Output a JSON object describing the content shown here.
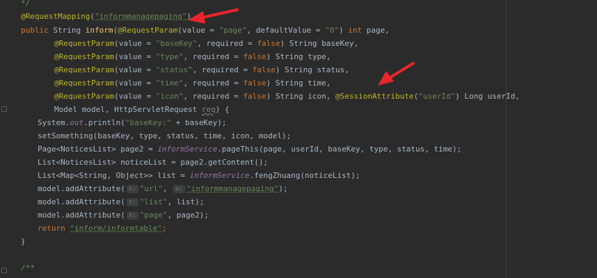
{
  "editor": {
    "tokens": {
      "comment_end": "*/",
      "request_mapping": "@RequestMapping",
      "lparen": "(",
      "rparen": ")",
      "mapping_value": "\"informmanagepaging\"",
      "public": "public",
      "string_type": " String ",
      "method_name": "inform",
      "request_param": "@RequestParam",
      "value_eq": "(value = ",
      "page_str": "\"page\"",
      "default_value": ", defaultValue = ",
      "zero_str": "\"0\"",
      "int_kw": "int",
      "page_param": " page,",
      "basekey_str": "\"baseKey\"",
      "required": ", required = ",
      "false_kw": "false",
      "basekey_param": ") String baseKey,",
      "type_str": "\"type\"",
      "type_param": ") String type,",
      "status_str": "\"status\"",
      "status_param": ") String status,",
      "time_str": "\"time\"",
      "time_param": ") String time,",
      "icon_str": "\"icon\"",
      "icon_param": ") String icon, ",
      "session_attr": "@SessionAttribute",
      "userid_str": "\"userId\"",
      "userid_param": ") Long userId,",
      "model_line": "Model model, HttpServletRequest ",
      "req_param": "req",
      "open_brace": ") {",
      "system": "System.",
      "out": "out",
      "println": ".println(",
      "basekey_label": "\"baseKey:\"",
      "println_rest": " + baseKey);",
      "set_something": "setSomething(baseKey, type, status, time, icon, model);",
      "page_decl": "Page<NoticesList> page2 = ",
      "inform_service": "informService",
      "page_this": ".pageThis(page, userId, baseKey, type, status, time);",
      "list_decl": "List<NoticesList> noticeList = page2.getContent();",
      "listmap_decl": "List<Map<String, Object>> list = ",
      "feng_zhuang": ".fengZhuang(noticeList);",
      "model_add": "model.addAttribute(",
      "hint_s": "s:",
      "hint_o": "o:",
      "url_str": "\"url\"",
      "comma": ", ",
      "inform_paging_str": "\"informmanagepaging\"",
      "end_paren": ");",
      "list_str": "\"list\"",
      "list_end": "list);",
      "page2_str": "\"page\"",
      "page2_end": "page2);",
      "return_kw": "return",
      "return_str": "\"inform/informtable\"",
      "semicolon": ";",
      "close_brace": "}",
      "javadoc_open": "/**"
    },
    "colors": {
      "background": "#2b2b2b",
      "arrow": "#e8262b"
    }
  }
}
